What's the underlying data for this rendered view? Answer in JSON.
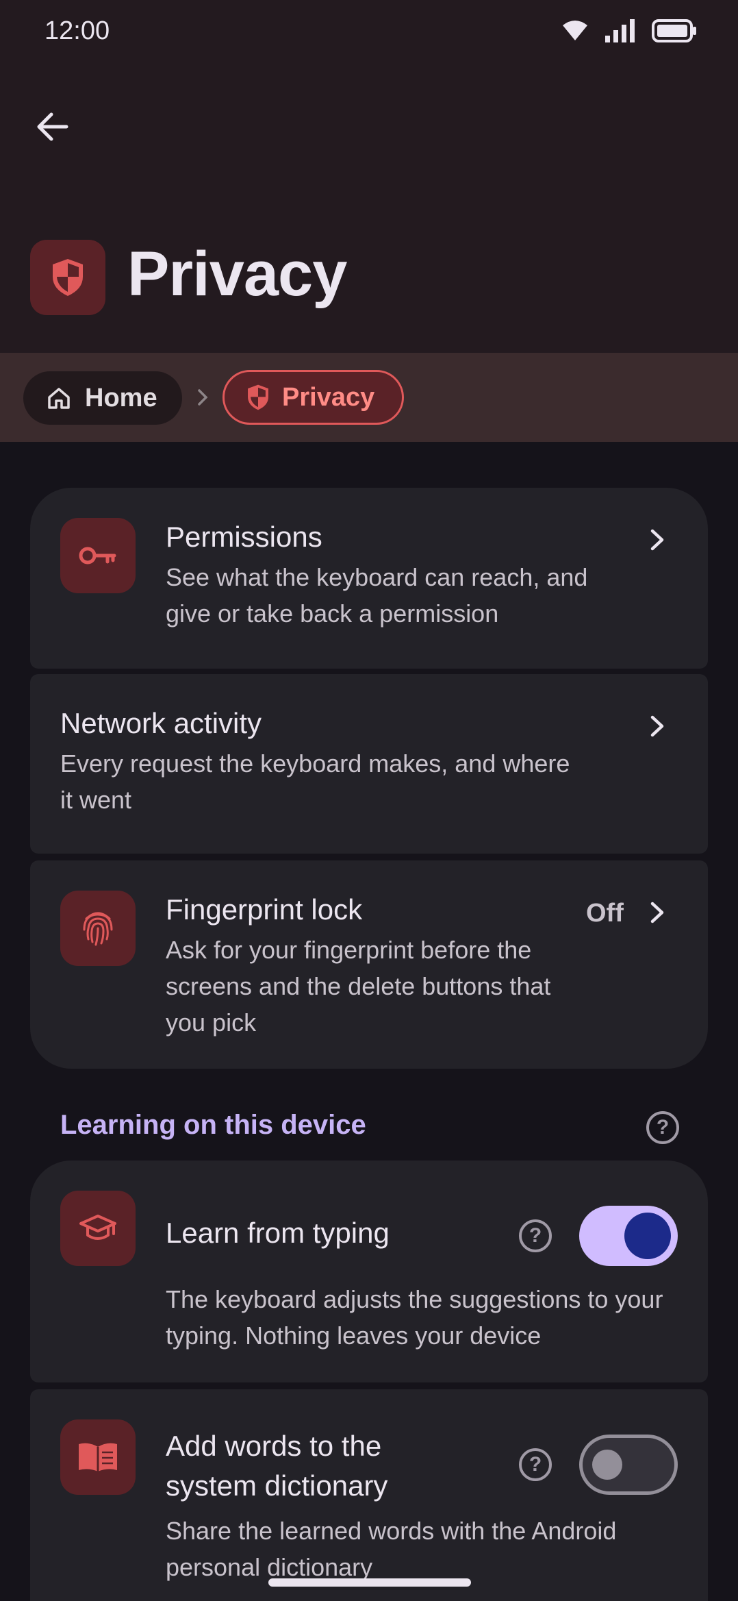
{
  "status_bar": {
    "time": "12:00"
  },
  "header": {
    "title": "Privacy"
  },
  "breadcrumb": {
    "home": "Home",
    "current": "Privacy"
  },
  "items": {
    "permissions": {
      "title": "Permissions",
      "description": "See what the keyboard can reach, and give or take back a permission",
      "icon": "key-icon"
    },
    "network": {
      "title": "Network activity",
      "description": "Every request the keyboard makes, and where it went"
    },
    "fingerprint": {
      "title": "Fingerprint lock",
      "description": "Ask for your fingerprint before the screens and the delete buttons that you pick",
      "value": "Off",
      "icon": "fingerprint-icon"
    }
  },
  "learning_section": {
    "label": "Learning on this device",
    "learn_from_typing": {
      "title": "Learn from typing",
      "description": "The keyboard adjusts the suggestions to your typing. Nothing leaves your device",
      "enabled": true,
      "icon": "graduation-cap-icon"
    },
    "system_dictionary": {
      "title": "Add words to the system dictionary",
      "description": "Share the learned words with the Android personal dictionary",
      "enabled": false,
      "icon": "book-icon"
    }
  },
  "colors": {
    "accent": "#e0595a",
    "section_label": "#c6b3f5",
    "toggle_on": "#d0bcff"
  }
}
